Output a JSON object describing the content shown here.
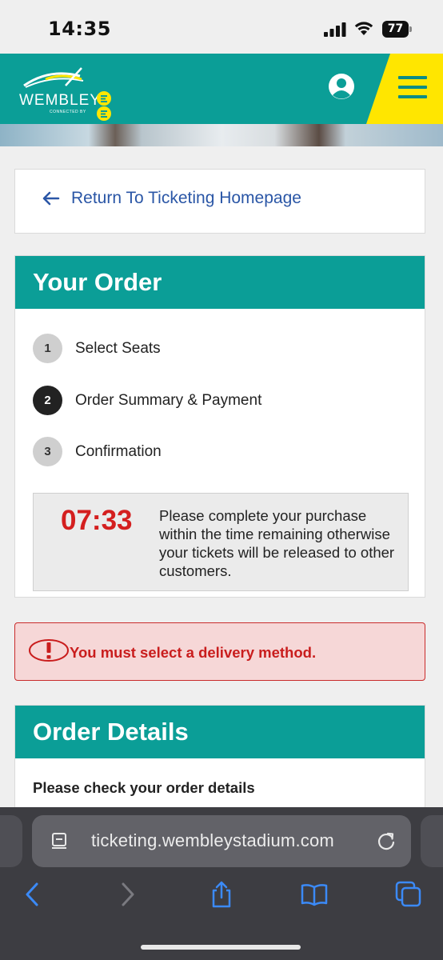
{
  "status_bar": {
    "time": "14:35",
    "battery": "77",
    "icons": [
      "cellular-signal-icon",
      "wifi-icon",
      "battery-icon"
    ]
  },
  "header": {
    "logo_text": "WEMBLEY",
    "logo_sub": "CONNECTED BY",
    "icons": [
      "account-icon",
      "hamburger-menu-icon"
    ],
    "colors": {
      "teal": "#0b9e97",
      "yellow": "#ffe600"
    }
  },
  "back": {
    "label": "Return To Ticketing Homepage"
  },
  "order": {
    "title": "Your Order",
    "steps": [
      {
        "num": "1",
        "label": "Select Seats",
        "active": false
      },
      {
        "num": "2",
        "label": "Order Summary & Payment",
        "active": true
      },
      {
        "num": "3",
        "label": "Confirmation",
        "active": false
      }
    ],
    "timer": "07:33",
    "timer_message": "Please complete your purchase within the time remaining otherwise your tickets will be released to other customers."
  },
  "alert": {
    "message": "You must select a delivery method.",
    "color": "#c91d1d"
  },
  "details": {
    "title": "Order Details",
    "subtitle": "Please check your order details"
  },
  "browser": {
    "url": "ticketing.wembleystadium.com",
    "toolbar_icons": [
      "back-icon",
      "forward-icon",
      "share-icon",
      "bookmarks-icon",
      "tabs-icon"
    ]
  }
}
